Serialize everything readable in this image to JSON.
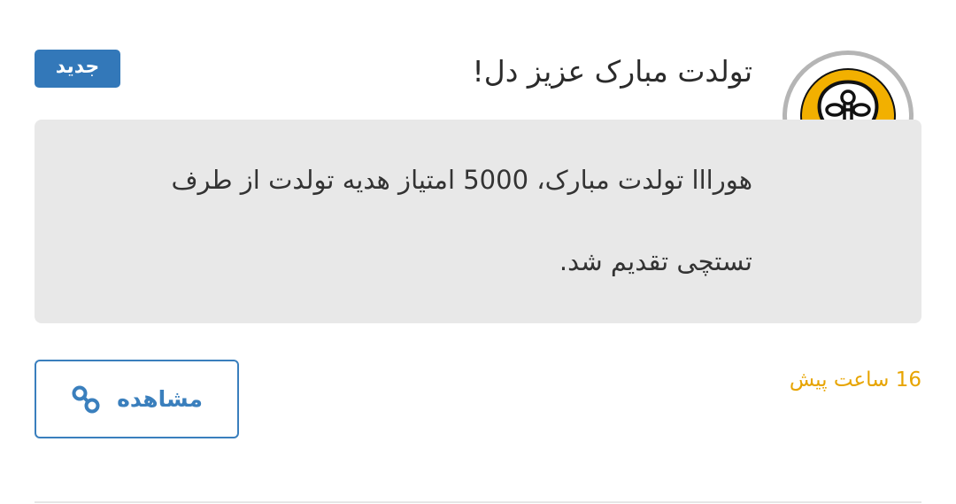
{
  "notification": {
    "title": "تولدت مبارک عزیز دل!",
    "badge": "جدید",
    "message_line1": "هورااا تولدت مبارک، 5000 امتیاز هدیه تولدت از طرف",
    "message_line2": "تستچی تقدیم شد.",
    "timestamp": "16 ساعت پیش",
    "view_button_label": "مشاهده",
    "avatar_icon": "lightbulb-icon",
    "link_icon": "link-icon"
  },
  "colors": {
    "badge_bg": "#3378b9",
    "button_accent": "#3a7fbd",
    "timestamp": "#e7a400",
    "message_bg": "#e8e8e8",
    "avatar_fill": "#f2b000"
  }
}
